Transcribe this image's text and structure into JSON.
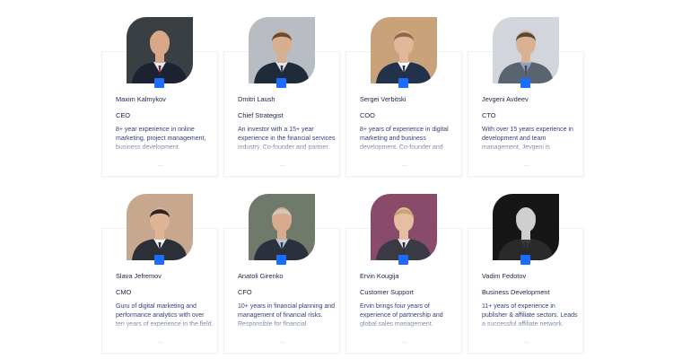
{
  "colors": {
    "accent": "#1a6dff",
    "text": "#1d2447",
    "body_text": "#33407a",
    "muted": "#b0b4c8",
    "border": "#eef0f6"
  },
  "team": [
    {
      "name": "Maxim Kalmykov",
      "role": "CEO",
      "description": "8+ year experience in online marketing, project management, business development.",
      "more": "...",
      "photo": {
        "bg": "#3a3f44",
        "skin": "#d9a889",
        "hair": "#d9a889",
        "suit": "#1d2233",
        "shirt": "#e6e9ee",
        "tie": "#7d2233"
      },
      "badge_icon": "linkedin-icon"
    },
    {
      "name": "Dmitri Laush",
      "role": "Chief Strategist",
      "description": "An investor with a 15+ year experience in the financial services industry. Co-founder and partner.",
      "more": "...",
      "photo": {
        "bg": "#b7bdc3",
        "skin": "#d7ae90",
        "hair": "#6a4a32",
        "suit": "#1f2a3a",
        "shirt": "#dfe6ee",
        "tie": "#2a3550"
      },
      "badge_icon": "linkedin-icon"
    },
    {
      "name": "Sergei Verbitski",
      "role": "COO",
      "description": "8+ years of experience in digital marketing and business development. Co-founder and partner.",
      "more": "...",
      "photo": {
        "bg": "#c9a27a",
        "skin": "#e2b89a",
        "hair": "#8a6a4a",
        "suit": "#22324a",
        "shirt": "#ffffff",
        "tie": "#22324a"
      },
      "badge_icon": "linkedin-icon"
    },
    {
      "name": "Jevgeni Avdeev",
      "role": "CTO",
      "description": "With over 15 years experience in development and team management, Jevgeni is responsible for technology.",
      "more": "...",
      "photo": {
        "bg": "#d2d6dc",
        "skin": "#d9b294",
        "hair": "#5a4632",
        "suit": "#5a6470",
        "shirt": "#8fa2c0",
        "tie": "#3c4656"
      },
      "badge_icon": "linkedin-icon"
    },
    {
      "name": "Slava Jefremov",
      "role": "CMO",
      "description": "Guru of digital marketing and performance analytics with over ten years of experience in the field.",
      "more": "...",
      "photo": {
        "bg": "#c7a88e",
        "skin": "#e0b496",
        "hair": "#2f2622",
        "suit": "#2a2f38",
        "shirt": "#f2f2f2",
        "tie": "#2a2f38"
      },
      "badge_icon": "linkedin-icon"
    },
    {
      "name": "Anatoli Girenko",
      "role": "CFO",
      "description": "10+ years in financial planning and management of financial risks. Responsible for financial operations.",
      "more": "...",
      "photo": {
        "bg": "#6f7a6a",
        "skin": "#d6aa8a",
        "hair": "#cfc8bc",
        "suit": "#2a303c",
        "shirt": "#b7c6d8",
        "tie": "#2e3a4e"
      },
      "badge_icon": "linkedin-icon"
    },
    {
      "name": "Ervin Kougija",
      "role": "Customer Support",
      "description": "Ervin brings four years of experience of partnership and global sales management.",
      "more": "...",
      "photo": {
        "bg": "#8a4a6a",
        "skin": "#e6bfa2",
        "hair": "#c9a574",
        "suit": "#3a3a44",
        "shirt": "#e8e8ec",
        "tie": "#2a2a30"
      },
      "badge_icon": "linkedin-icon"
    },
    {
      "name": "Vadim Fedotov",
      "role": "Business Development",
      "description": "11+ years of experience in publisher & affiliate sectors. Leads a successful affiliate network.",
      "more": "...",
      "photo": {
        "bg": "#161616",
        "skin": "#cfcfcf",
        "hair": "#cfcfcf",
        "suit": "#2a2a2a",
        "shirt": "#3a3a3a",
        "tie": "#2a2a2a"
      },
      "badge_icon": "linkedin-icon"
    }
  ]
}
